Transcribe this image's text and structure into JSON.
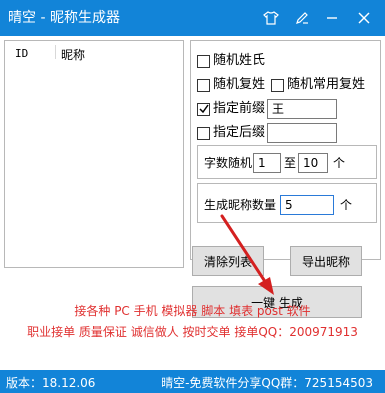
{
  "window": {
    "title": "晴空 - 昵称生成器",
    "icons": [
      "tshirt-icon",
      "pencil-icon",
      "minimize-icon",
      "close-icon"
    ]
  },
  "list": {
    "columns": [
      "ID",
      "昵称"
    ]
  },
  "options": {
    "random_surname": {
      "label": "随机姓氏",
      "checked": false
    },
    "random_compound": {
      "label": "随机复姓",
      "checked": false
    },
    "random_common_compound": {
      "label": "随机常用复姓",
      "checked": false
    },
    "specified_prefix": {
      "label": "指定前缀",
      "checked": true,
      "value": "王"
    },
    "specified_suffix": {
      "label": "指定后缀",
      "checked": false,
      "value": ""
    }
  },
  "length": {
    "label": "字数随机",
    "min": "1",
    "to": "至",
    "max": "10",
    "unit": "个"
  },
  "count": {
    "label": "生成昵称数量",
    "value": "5",
    "unit": "个"
  },
  "buttons": {
    "clear": "清除列表",
    "export": "导出昵称",
    "generate": "一键 生成"
  },
  "ads": {
    "line1": "接各种 PC 手机 模拟器 脚本 填表 post 软件",
    "line2": "职业接单 质量保证 诚信做人 按时交单  接单QQ：200971913"
  },
  "status": {
    "version": "版本：18.12.06",
    "qq_group": "晴空-免费软件分享QQ群：725154503"
  },
  "colors": {
    "titlebar": "#1284d8",
    "ad_text": "#e03030",
    "arrow": "#d42020"
  }
}
